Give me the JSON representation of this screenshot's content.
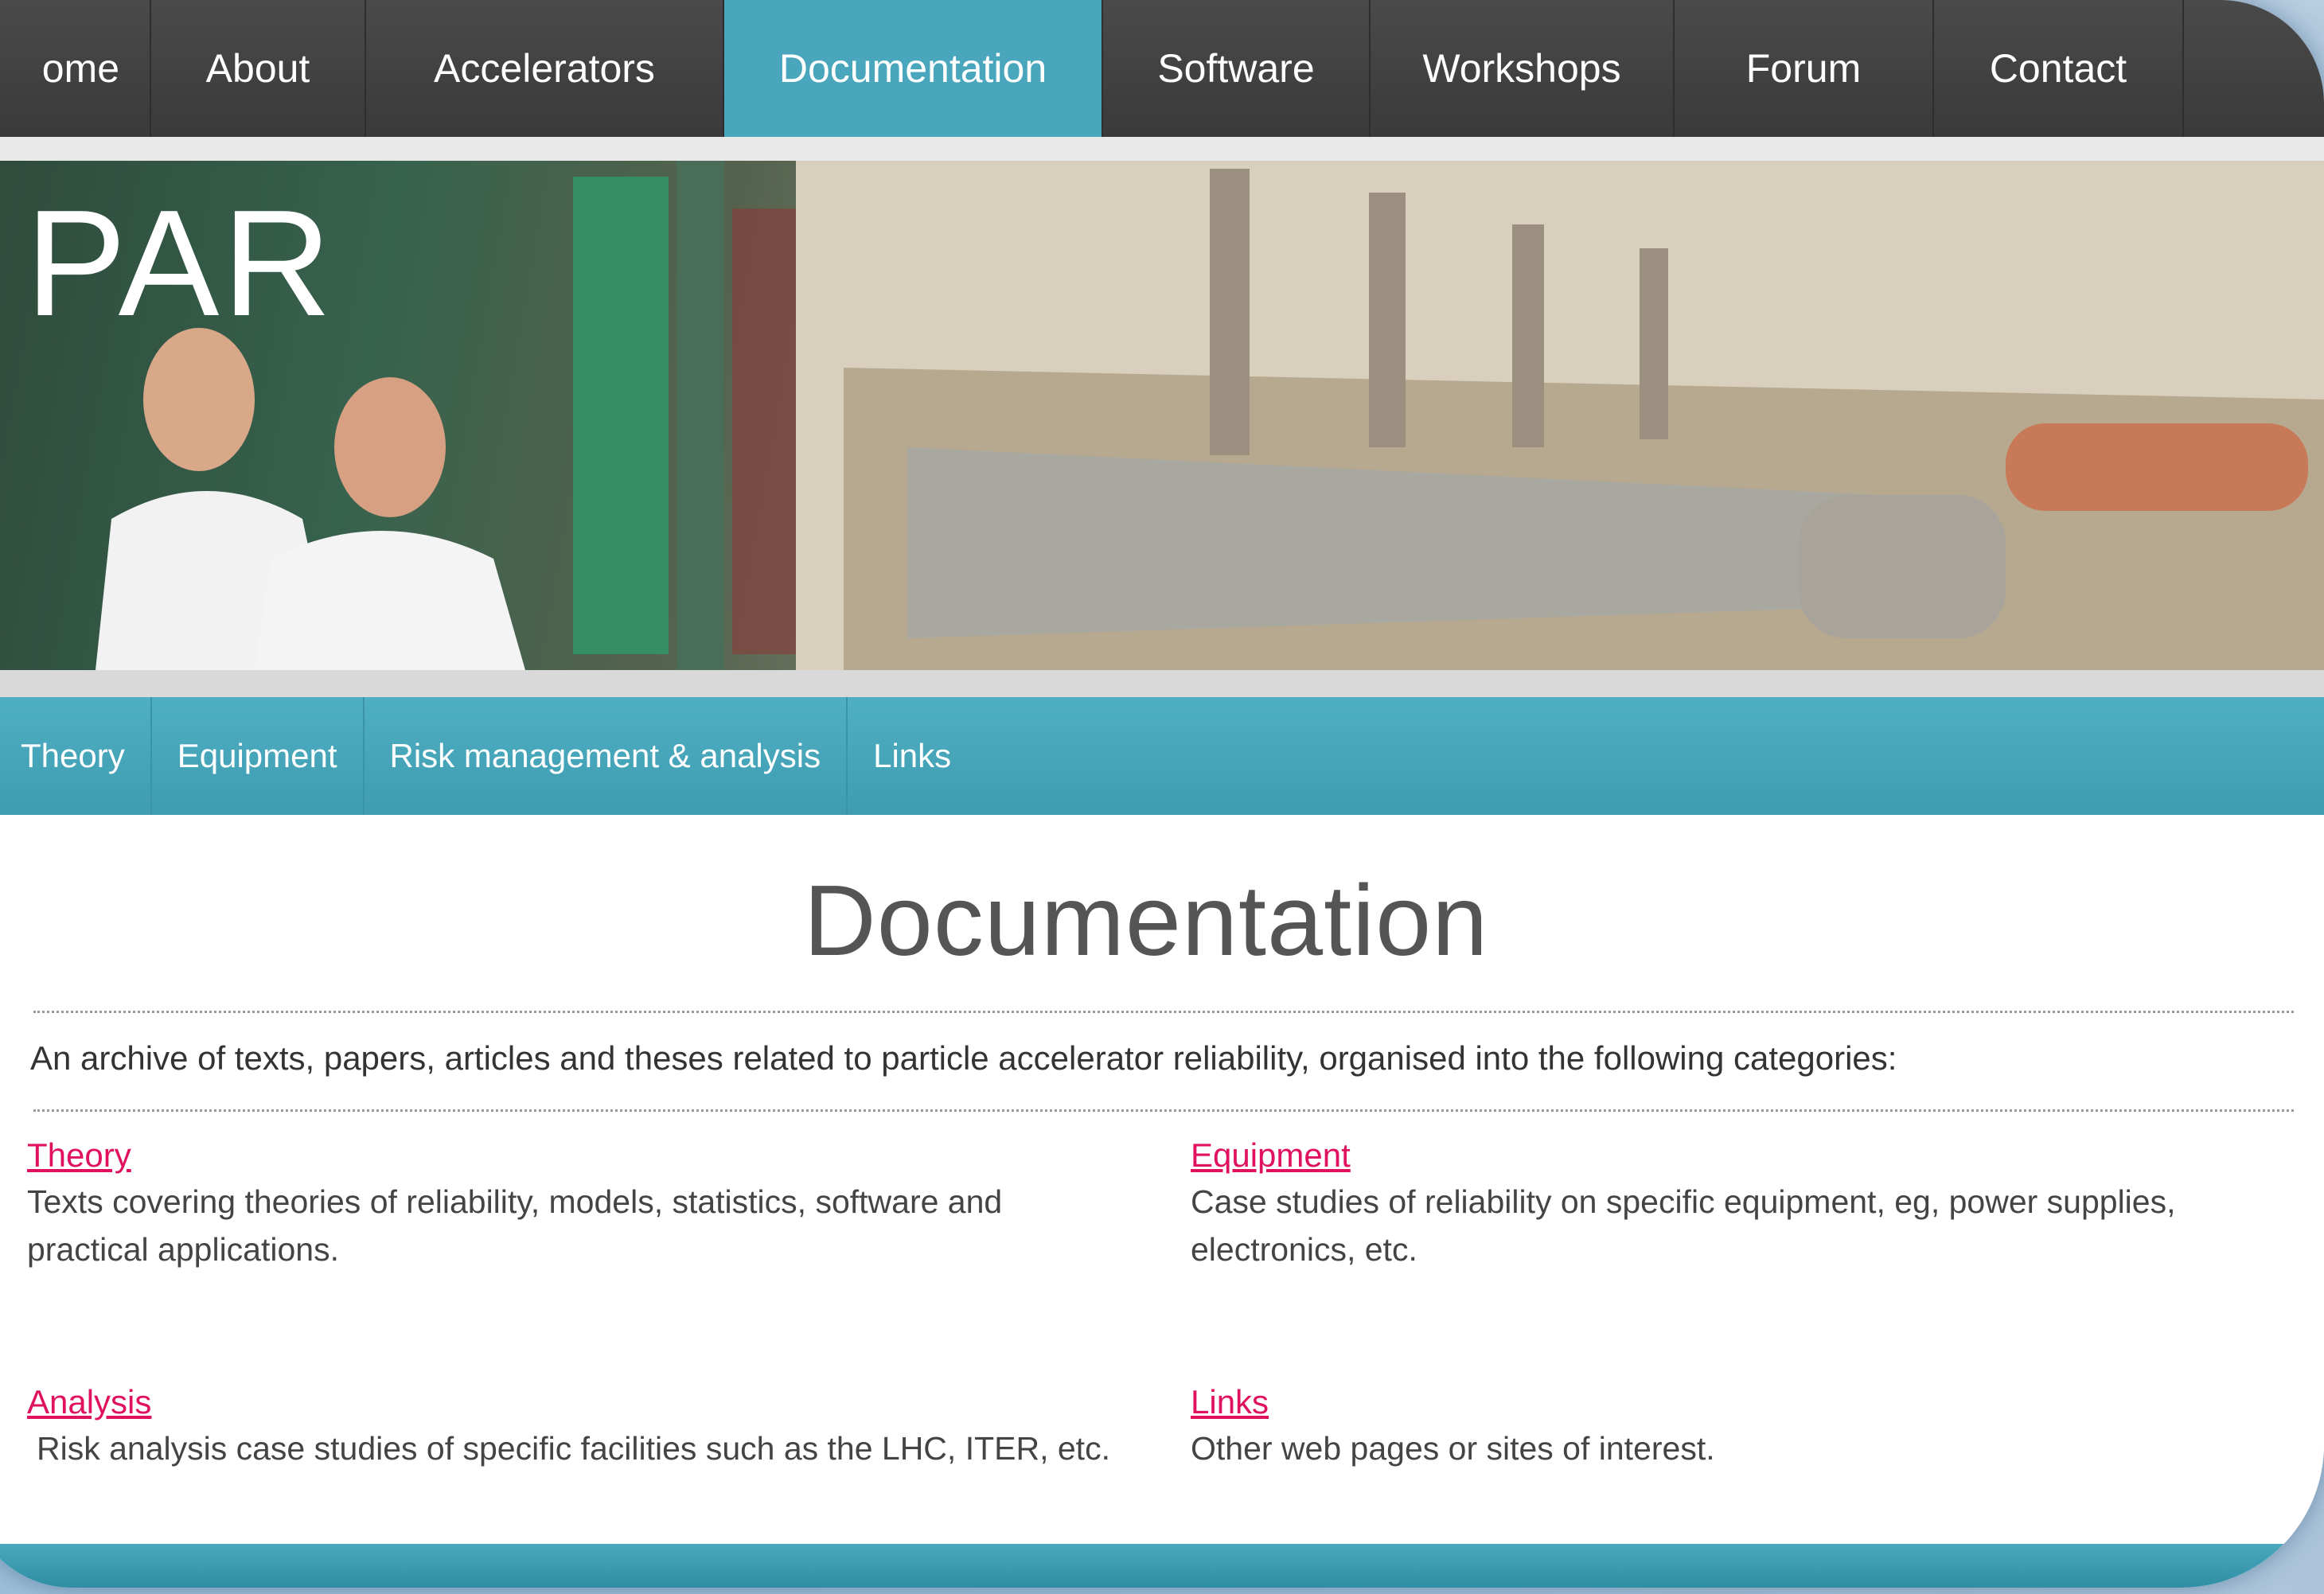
{
  "nav": {
    "items": [
      {
        "label": "ome",
        "active": false
      },
      {
        "label": "About",
        "active": false
      },
      {
        "label": "Accelerators",
        "active": false
      },
      {
        "label": "Documentation",
        "active": true
      },
      {
        "label": "Software",
        "active": false
      },
      {
        "label": "Workshops",
        "active": false
      },
      {
        "label": "Forum",
        "active": false
      },
      {
        "label": "Contact",
        "active": false
      }
    ]
  },
  "banner": {
    "logo_text": "PAR"
  },
  "subnav": {
    "items": [
      {
        "label": "Theory"
      },
      {
        "label": "Equipment"
      },
      {
        "label": "Risk management & analysis"
      },
      {
        "label": "Links"
      }
    ]
  },
  "page": {
    "title": "Documentation",
    "intro": "An archive of texts, papers, articles and theses related to particle accelerator reliability, organised into the following categories:"
  },
  "categories": [
    {
      "link": "Theory",
      "desc": "Texts covering theories of reliability, models, statistics, software and practical applications."
    },
    {
      "link": "Equipment",
      "desc": "Case studies of reliability on specific equipment, eg, power supplies, electronics, etc."
    },
    {
      "link": "Analysis",
      "desc": "Risk analysis case studies of specific facilities such as the LHC, ITER, etc."
    },
    {
      "link": "Links",
      "desc": "Other web pages or sites of interest."
    }
  ],
  "colors": {
    "nav_bg": "#3f3f3f",
    "nav_active": "#49a6bc",
    "subnav_bg": "#46a5ba",
    "link": "#e0115f",
    "title": "#555555"
  }
}
